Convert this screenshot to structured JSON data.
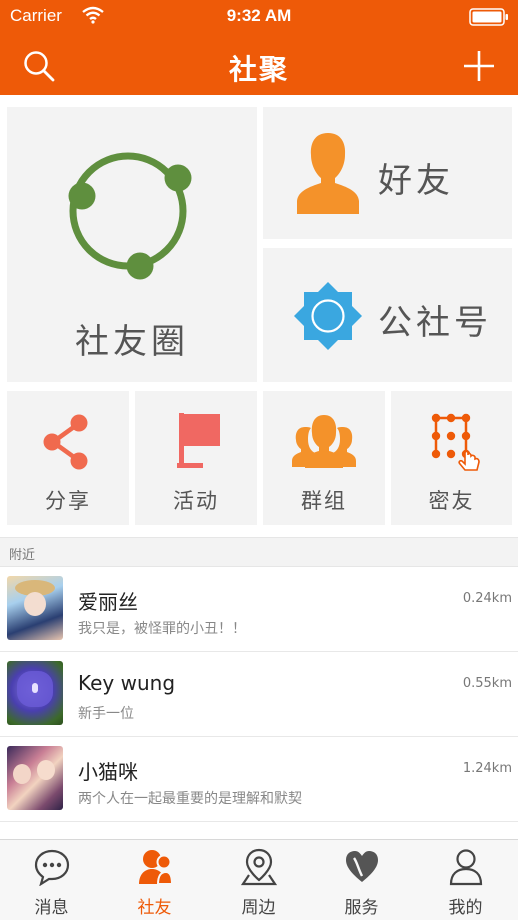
{
  "status_bar": {
    "carrier": "Carrier",
    "time": "9:32 AM"
  },
  "nav": {
    "title": "社聚",
    "left_icon": "search-icon",
    "right_icon": "plus-icon"
  },
  "tiles": {
    "moments": {
      "label": "社友圈",
      "icon": "circle-network-icon"
    },
    "friends": {
      "label": "好友",
      "icon": "person-icon"
    },
    "public": {
      "label": "公社号",
      "icon": "badge-icon"
    },
    "share": {
      "label": "分享",
      "icon": "share-icon"
    },
    "events": {
      "label": "活动",
      "icon": "flag-icon"
    },
    "groups": {
      "label": "群组",
      "icon": "group-icon"
    },
    "secret": {
      "label": "密友",
      "icon": "pattern-lock-icon"
    }
  },
  "nearby": {
    "header": "附近",
    "items": [
      {
        "name": "爱丽丝",
        "message": "我只是，被怪罪的小丑！！",
        "distance": "0.24km"
      },
      {
        "name": "Key wung",
        "message": "新手一位",
        "distance": "0.55km"
      },
      {
        "name": "小猫咪",
        "message": "两个人在一起最重要的是理解和默契",
        "distance": "1.24km"
      }
    ]
  },
  "tabbar": {
    "items": [
      {
        "label": "消息",
        "icon": "chat-icon"
      },
      {
        "label": "社友",
        "icon": "contacts-icon",
        "active": true
      },
      {
        "label": "周边",
        "icon": "location-icon"
      },
      {
        "label": "服务",
        "icon": "heart-icon"
      },
      {
        "label": "我的",
        "icon": "profile-icon"
      }
    ]
  },
  "colors": {
    "brand": "#ee5a08",
    "green": "#5f8f3e",
    "orange": "#f4922a",
    "blue": "#3aa7e0",
    "red": "#f06862",
    "share": "#f06a4e"
  }
}
